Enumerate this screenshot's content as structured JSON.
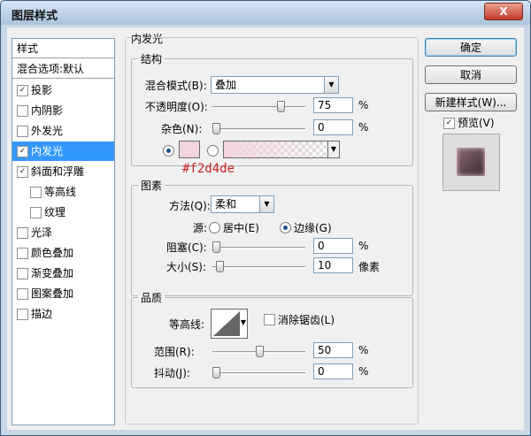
{
  "window": {
    "title": "图层样式",
    "close": "X"
  },
  "sidebar": {
    "header": "样式",
    "blend_options": "混合选项:默认",
    "items": [
      {
        "label": "投影",
        "checked": true
      },
      {
        "label": "内阴影",
        "checked": false
      },
      {
        "label": "外发光",
        "checked": false
      },
      {
        "label": "内发光",
        "checked": true,
        "selected": true
      },
      {
        "label": "斜面和浮雕",
        "checked": true
      },
      {
        "label": "等高线",
        "checked": false,
        "sub": true
      },
      {
        "label": "纹理",
        "checked": false,
        "sub": true
      },
      {
        "label": "光泽",
        "checked": false
      },
      {
        "label": "颜色叠加",
        "checked": false
      },
      {
        "label": "渐变叠加",
        "checked": false
      },
      {
        "label": "图案叠加",
        "checked": false
      },
      {
        "label": "描边",
        "checked": false
      }
    ]
  },
  "panel": {
    "title": "内发光",
    "structure": {
      "title": "结构",
      "blend_mode_label": "混合模式(B):",
      "blend_mode_value": "叠加",
      "opacity_label": "不透明度(O):",
      "opacity_value": "75",
      "opacity_unit": "%",
      "opacity_level": 0.75,
      "noise_label": "杂色(N):",
      "noise_value": "0",
      "noise_unit": "%",
      "noise_level": 0,
      "color_swatch": "#f2d4de",
      "annotation": "#f2d4de"
    },
    "elements": {
      "title": "图素",
      "method_label": "方法(Q):",
      "method_value": "柔和",
      "source_label": "源:",
      "source_center": "居中(E)",
      "source_edge": "边缘(G)",
      "choke_label": "阻塞(C):",
      "choke_value": "0",
      "choke_unit": "%",
      "choke_level": 0,
      "size_label": "大小(S):",
      "size_value": "10",
      "size_unit": "像素",
      "size_level": 0.04
    },
    "quality": {
      "title": "品质",
      "contour_label": "等高线:",
      "antialias_label": "消除锯齿(L)",
      "range_label": "范围(R):",
      "range_value": "50",
      "range_unit": "%",
      "range_level": 0.5,
      "jitter_label": "抖动(J):",
      "jitter_value": "0",
      "jitter_unit": "%",
      "jitter_level": 0
    }
  },
  "buttons": {
    "ok": "确定",
    "cancel": "取消",
    "new_style": "新建样式(W)...",
    "preview_label": "预览(V)"
  },
  "colors": {
    "accent": "#3399ff",
    "annotation": "#cc2222"
  }
}
